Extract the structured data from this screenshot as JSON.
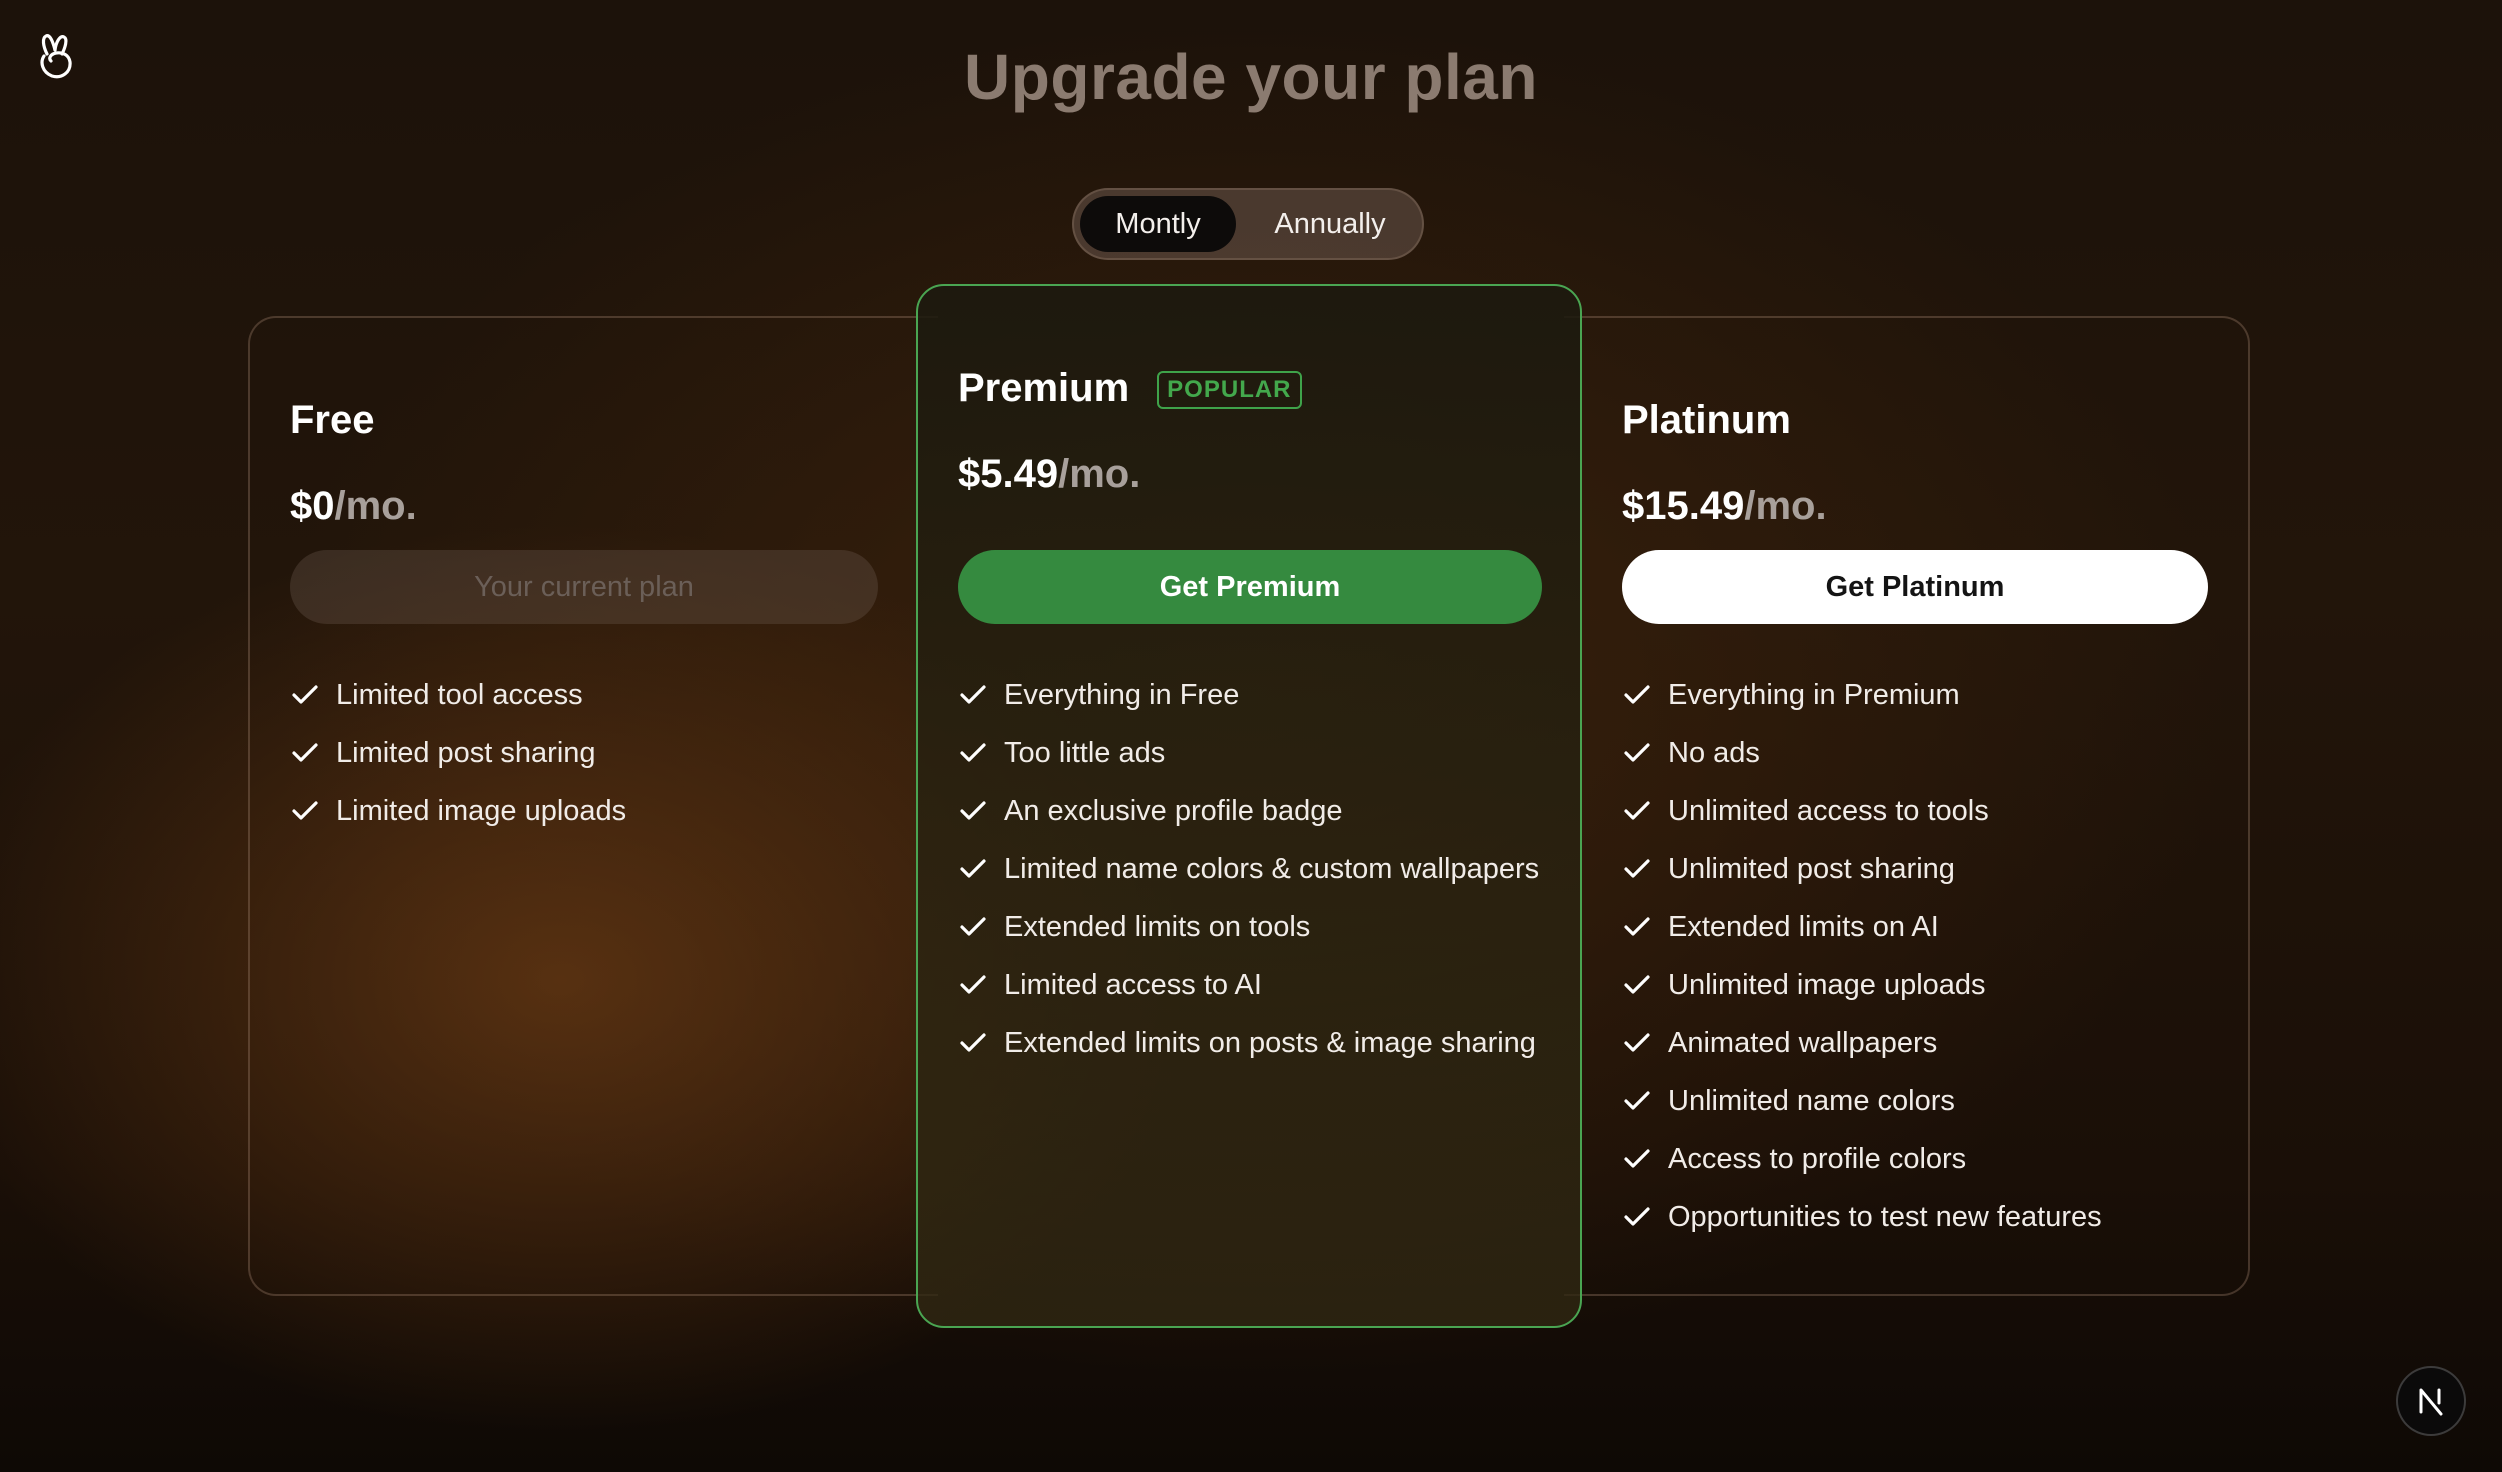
{
  "header": {
    "title": "Upgrade your plan"
  },
  "billing_toggle": {
    "options": [
      "Montly",
      "Annually"
    ],
    "selected": "Montly"
  },
  "plans": [
    {
      "name": "Free",
      "badge": "",
      "price": "$0",
      "unit": "/mo.",
      "cta": "Your current plan",
      "features": [
        "Limited tool access",
        "Limited post sharing",
        "Limited image uploads"
      ]
    },
    {
      "name": "Premium",
      "badge": "POPULAR",
      "price": "$5.49",
      "unit": "/mo.",
      "cta": "Get Premium",
      "features": [
        "Everything in Free",
        "Too little ads",
        "An exclusive profile badge",
        "Limited name colors & custom wallpapers",
        "Extended limits on tools",
        "Limited access to AI",
        "Extended limits on posts & image sharing"
      ]
    },
    {
      "name": "Platinum",
      "badge": "",
      "price": "$15.49",
      "unit": "/mo.",
      "cta": "Get Platinum",
      "features": [
        "Everything in Premium",
        "No ads",
        "Unlimited access to tools",
        "Unlimited post sharing",
        "Extended limits on AI",
        "Unlimited image uploads",
        "Animated wallpapers",
        "Unlimited name colors",
        "Access to profile colors",
        "Opportunities to test new features"
      ]
    }
  ],
  "colors": {
    "accent_green": "#358a3f",
    "badge_green": "#43a84c",
    "title_muted": "#8b7b70"
  },
  "icons": {
    "logo": "rabbit-hand-logo-icon",
    "check": "check-icon",
    "dev_badge": "nextjs-n-icon"
  }
}
